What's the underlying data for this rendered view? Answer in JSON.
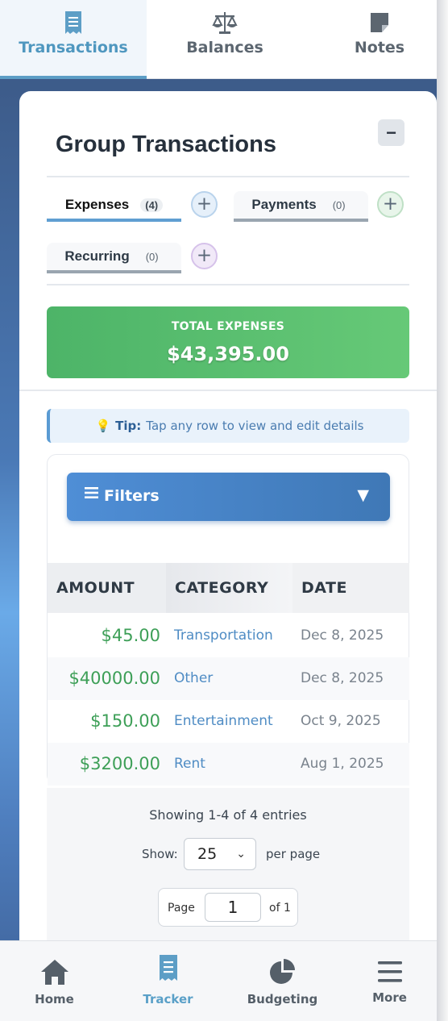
{
  "top_tabs": [
    {
      "label": "Transactions",
      "icon": "receipt-icon",
      "active": true
    },
    {
      "label": "Balances",
      "icon": "scale-icon",
      "active": false
    },
    {
      "label": "Notes",
      "icon": "note-icon",
      "active": false
    }
  ],
  "card": {
    "title": "Group Transactions",
    "collapse_label": "−"
  },
  "subtabs": {
    "expenses": {
      "label": "Expenses",
      "count": "(4)"
    },
    "payments": {
      "label": "Payments",
      "count": "(0)"
    },
    "recurring": {
      "label": "Recurring",
      "count": "(0)"
    },
    "add_label": "+"
  },
  "total": {
    "label": "TOTAL EXPENSES",
    "value": "$43,395.00"
  },
  "tip": {
    "icon": "💡",
    "prefix": "Tip:",
    "text": "Tap any row to view and edit details"
  },
  "filters": {
    "label": "Filters",
    "chevron": "▼"
  },
  "table": {
    "headers": [
      "AMOUNT",
      "CATEGORY",
      "DATE"
    ],
    "rows": [
      {
        "amount": "$45.00",
        "category": "Transportation",
        "date": "Dec 8, 2025"
      },
      {
        "amount": "$40000.00",
        "category": "Other",
        "date": "Dec 8, 2025"
      },
      {
        "amount": "$150.00",
        "category": "Entertainment",
        "date": "Oct 9, 2025"
      },
      {
        "amount": "$3200.00",
        "category": "Rent",
        "date": "Aug 1, 2025"
      }
    ]
  },
  "pagination": {
    "showing": "Showing 1-4 of 4 entries",
    "show_label": "Show:",
    "per_page_value": "25",
    "per_page_label": "per page",
    "page_label": "Page",
    "page_value": "1",
    "of_label": "of 1"
  },
  "bottom_nav": [
    {
      "label": "Home",
      "icon": "home-icon",
      "active": false
    },
    {
      "label": "Tracker",
      "icon": "receipt-icon",
      "active": true
    },
    {
      "label": "Budgeting",
      "icon": "pie-chart-icon",
      "active": false
    },
    {
      "label": "More",
      "icon": "menu-icon",
      "active": false
    }
  ],
  "colors": {
    "accent": "#5d9ec6",
    "total_green": "#5cbf6f",
    "amount_green": "#3d9f57",
    "category_blue": "#4f8cc4",
    "filters_blue": "#4a86c8"
  }
}
